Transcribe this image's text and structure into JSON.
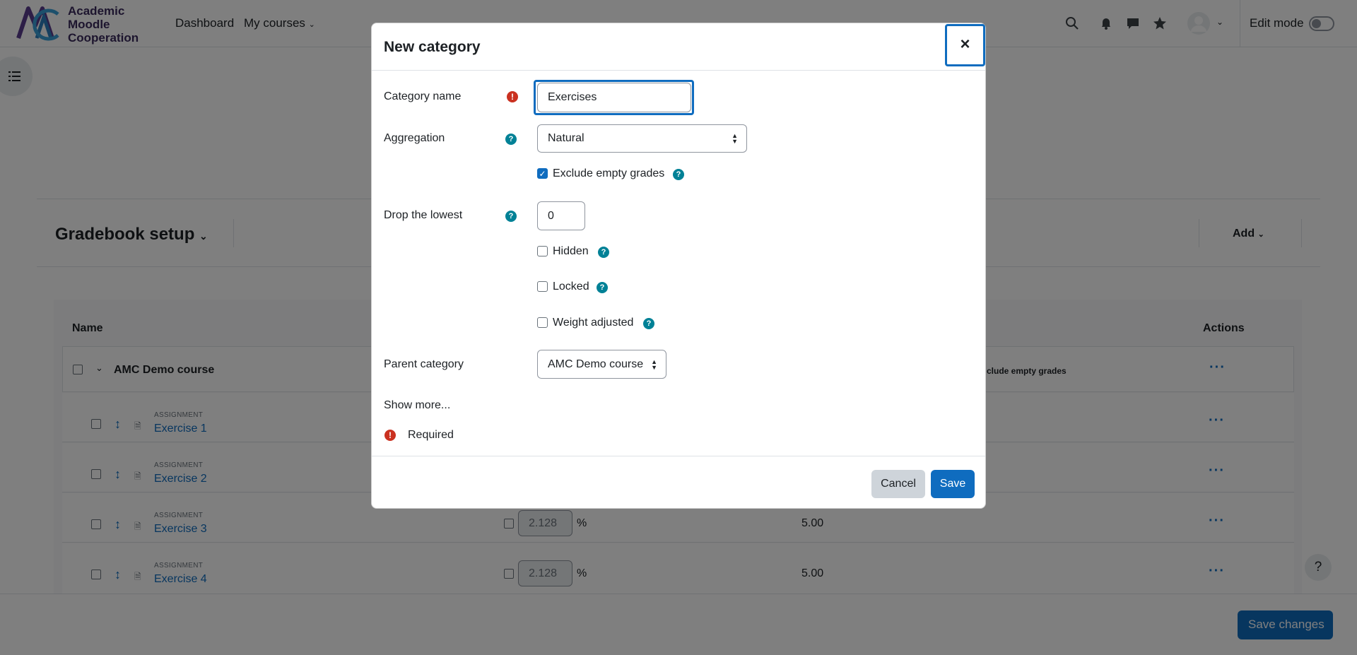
{
  "nav": {
    "logo_lines": [
      "Academic",
      "Moodle",
      "Cooperation"
    ],
    "links": [
      "Dashboard",
      "My courses"
    ],
    "edit_mode_label": "Edit mode",
    "icons": [
      "search-icon",
      "bell-icon",
      "chat-icon",
      "star-icon",
      "avatar",
      "chevron-down-icon"
    ]
  },
  "page": {
    "title": "Gradebook setup",
    "add_label": "Add",
    "table": {
      "headers": {
        "name": "Name",
        "actions": "Actions"
      },
      "category_row": {
        "name": "AMC Demo course",
        "right_text": "clude empty grades"
      },
      "items": [
        {
          "type": "ASSIGNMENT",
          "name": "Exercise 1"
        },
        {
          "type": "ASSIGNMENT",
          "name": "Exercise 2"
        },
        {
          "type": "ASSIGNMENT",
          "name": "Exercise 3",
          "weight": "2.128",
          "unit": "%",
          "max": "5.00"
        },
        {
          "type": "ASSIGNMENT",
          "name": "Exercise 4",
          "weight": "2.128",
          "unit": "%",
          "max": "5.00"
        }
      ]
    },
    "save_changes": "Save changes",
    "help_label": "?"
  },
  "modal": {
    "title": "New category",
    "close": "×",
    "fields": {
      "category_name": {
        "label": "Category name",
        "value": "Exercises"
      },
      "aggregation": {
        "label": "Aggregation",
        "value": "Natural"
      },
      "exclude_empty": {
        "label": "Exclude empty grades",
        "checked": true
      },
      "drop_lowest": {
        "label": "Drop the lowest",
        "value": "0"
      },
      "hidden": {
        "label": "Hidden",
        "checked": false
      },
      "locked": {
        "label": "Locked",
        "checked": false
      },
      "weight_adjusted": {
        "label": "Weight adjusted",
        "checked": false
      },
      "parent_category": {
        "label": "Parent category",
        "value": "AMC Demo course"
      }
    },
    "show_more": "Show more...",
    "required_label": "Required",
    "cancel_label": "Cancel",
    "save_label": "Save"
  },
  "colors": {
    "primary": "#0f6cbf",
    "required": "#ca3120",
    "help": "#008196"
  }
}
